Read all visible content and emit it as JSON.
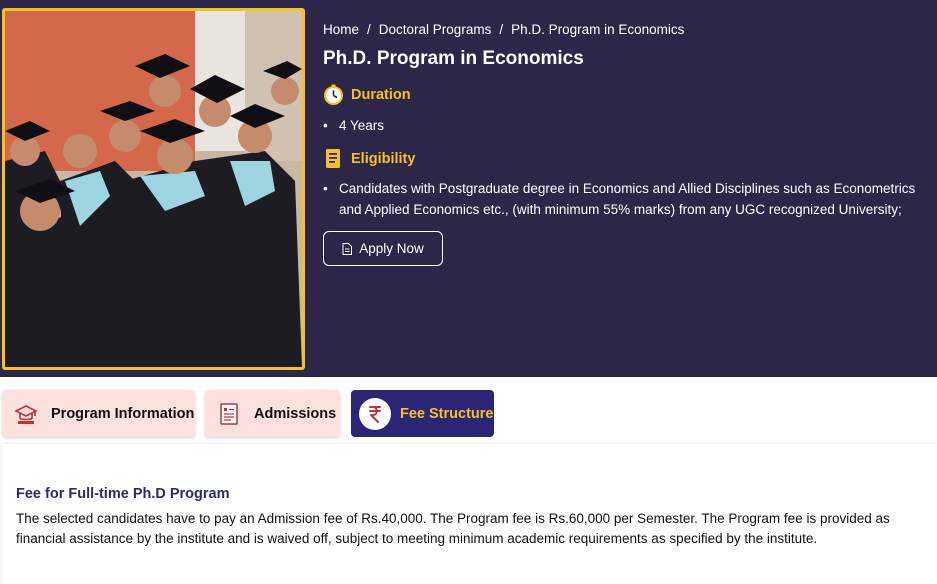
{
  "breadcrumb": {
    "items": [
      "Home",
      "Doctoral Programs",
      "Ph.D. Program in Economics"
    ],
    "separator": "/"
  },
  "page_title": "Ph.D. Program in Economics",
  "duration": {
    "heading": "Duration",
    "icon": "stopwatch-icon",
    "value": "4 Years"
  },
  "eligibility": {
    "heading": "Eligibility",
    "icon": "document-icon",
    "value": "Candidates with Postgraduate degree in Economics and Allied Disciplines such as Econometrics and Applied Economics etc., (with minimum 55% marks) from any UGC recognized University;"
  },
  "apply_button": {
    "label": "Apply Now",
    "icon": "document-icon"
  },
  "tabs": [
    {
      "label": "Program Information",
      "icon": "graduation-cap-icon",
      "active": false
    },
    {
      "label": "Admissions",
      "icon": "form-icon",
      "active": false
    },
    {
      "label": "Fee Structure",
      "icon": "rupee-icon",
      "active": true
    }
  ],
  "fee": {
    "title": "Fee for Full-time Ph.D Program",
    "text": "The selected candidates have to pay an Admission fee of Rs.40,000. The Program fee is Rs.60,000 per Semester. The Program fee is provided as financial assistance by the institute and is waived off, subject to meeting minimum academic requirements as specified by the institute."
  },
  "colors": {
    "hero_bg": "#2c2649",
    "accent": "#f7c21b",
    "tab_inactive_bg": "#fde1df",
    "tab_active_bg": "#2c2576",
    "fee_title": "#2c2a6b",
    "icon_red": "#c0313b"
  }
}
